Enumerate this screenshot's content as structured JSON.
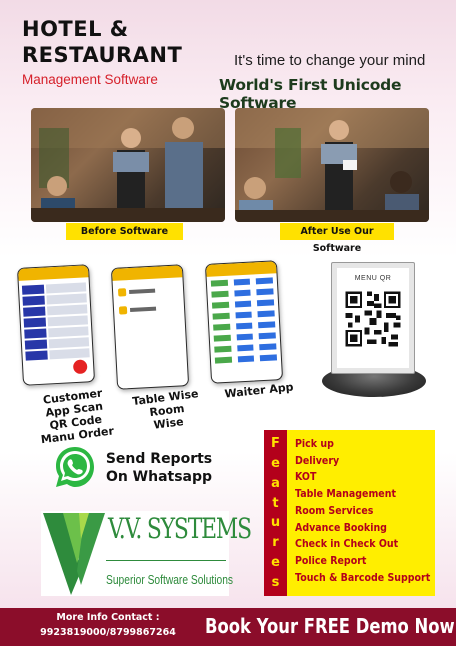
{
  "header": {
    "title": "HOTEL & RESTAURANT",
    "subtitle": "Management Software",
    "tagline": "It's time to change your mind",
    "headline": "World's First Unicode Software"
  },
  "comparison": {
    "before_caption": "Before Software",
    "after_caption": "After Use Our Software"
  },
  "apps": [
    {
      "label": "Customer App Scan QR Code Manu Order"
    },
    {
      "label": "Table Wise Room Wise"
    },
    {
      "label": "Waiter App"
    }
  ],
  "stand": {
    "label": "MENU QR"
  },
  "whatsapp": {
    "text": "Send Reports On Whatsapp"
  },
  "logo": {
    "name": "V.V. SYSTEMS",
    "tagline": "Superior Software Solutions"
  },
  "features": {
    "side_letters": [
      "F",
      "e",
      "a",
      "t",
      "u",
      "r",
      "e",
      "s"
    ],
    "items": [
      "Pick up",
      "Delivery",
      "KOT",
      "Table Management",
      "Room Services",
      "Advance Booking",
      "Check in Check Out",
      "Police Report",
      "Touch & Barcode Support"
    ]
  },
  "footer": {
    "contact_label": "More Info Contact :",
    "contact_phone": "9923819000/8799867264",
    "cta": "Book Your FREE Demo Now"
  },
  "colors": {
    "accent_red": "#b3001b",
    "feature_yellow": "#ffee00",
    "footer_maroon": "#8b0d2a",
    "logo_green": "#2e8b3c"
  }
}
